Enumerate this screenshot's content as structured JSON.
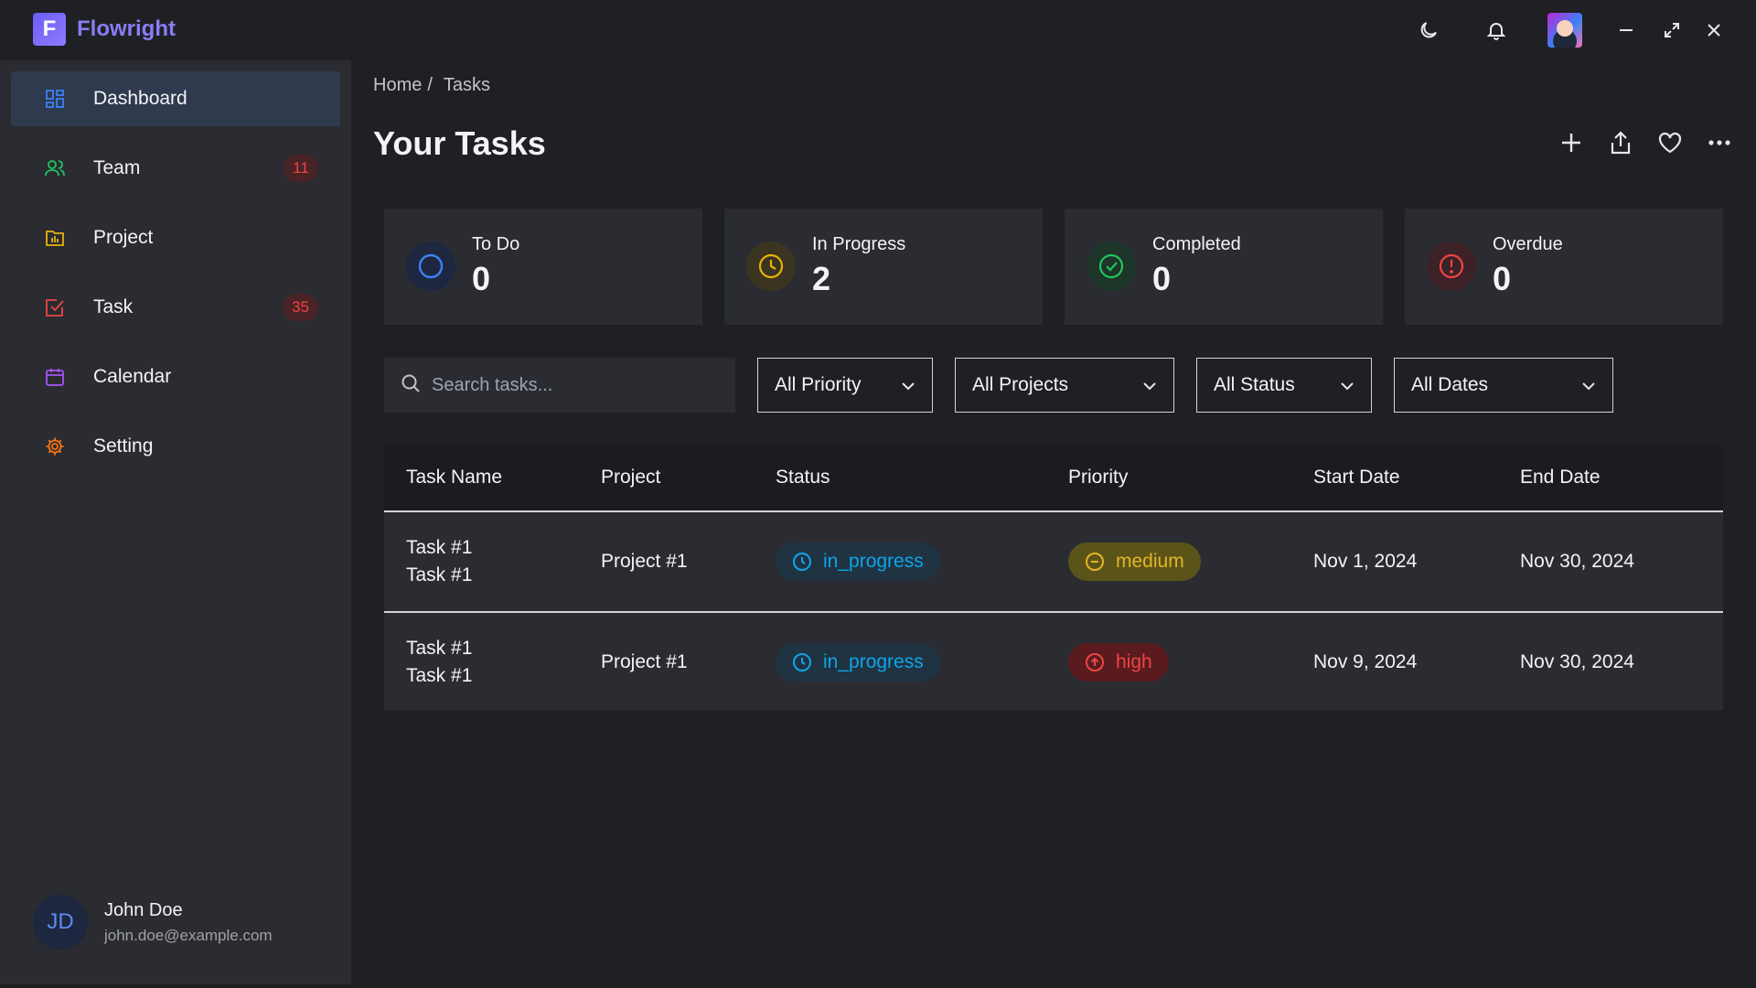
{
  "app": {
    "logo_letter": "F",
    "name": "Flowright"
  },
  "titlebar": {
    "icons": [
      "moon-icon",
      "bell-icon",
      "avatar",
      "minimize-icon",
      "maximize-icon",
      "close-icon"
    ]
  },
  "sidebar": {
    "items": [
      {
        "label": "Dashboard",
        "icon": "dashboard-icon",
        "active": true,
        "color": "#3b82f6"
      },
      {
        "label": "Team",
        "icon": "team-icon",
        "badge": "11",
        "color": "#22c55e"
      },
      {
        "label": "Project",
        "icon": "folder-icon",
        "color": "#eab308"
      },
      {
        "label": "Task",
        "icon": "task-check-icon",
        "badge": "35",
        "color": "#ef4444"
      },
      {
        "label": "Calendar",
        "icon": "calendar-icon",
        "color": "#a855f7"
      },
      {
        "label": "Setting",
        "icon": "gear-icon",
        "color": "#f97316"
      }
    ],
    "profile": {
      "initials": "JD",
      "name": "John Doe",
      "email": "john.doe@example.com"
    }
  },
  "breadcrumb": {
    "home": "Home",
    "separator": "/",
    "current": "Tasks"
  },
  "page": {
    "title": "Your Tasks"
  },
  "actions": [
    "plus-icon",
    "share-icon",
    "heart-icon",
    "more-icon"
  ],
  "stats": [
    {
      "label": "To Do",
      "value": "0",
      "icon": "circle-icon",
      "color": "#3b82f6",
      "bg": "#1e2740"
    },
    {
      "label": "In Progress",
      "value": "2",
      "icon": "clock-icon",
      "color": "#eab308",
      "bg": "#3a3420"
    },
    {
      "label": "Completed",
      "value": "0",
      "icon": "check-circle-icon",
      "color": "#22c55e",
      "bg": "#1e3529"
    },
    {
      "label": "Overdue",
      "value": "0",
      "icon": "alert-circle-icon",
      "color": "#ef4444",
      "bg": "#3c2226"
    }
  ],
  "filters": {
    "search_placeholder": "Search tasks...",
    "selects": [
      "All Priority",
      "All Projects",
      "All Status",
      "All Dates"
    ]
  },
  "table": {
    "headers": [
      "Task Name",
      "Project",
      "Status",
      "Priority",
      "Start Date",
      "End Date"
    ],
    "rows": [
      {
        "name_line1": "Task #1",
        "name_line2": "Task #1",
        "project": "Project #1",
        "status": "in_progress",
        "priority": "medium",
        "start": "Nov 1, 2024",
        "end": "Nov 30, 2024"
      },
      {
        "name_line1": "Task #1",
        "name_line2": "Task #1",
        "project": "Project #1",
        "status": "in_progress",
        "priority": "high",
        "start": "Nov 9, 2024",
        "end": "Nov 30, 2024"
      }
    ]
  }
}
